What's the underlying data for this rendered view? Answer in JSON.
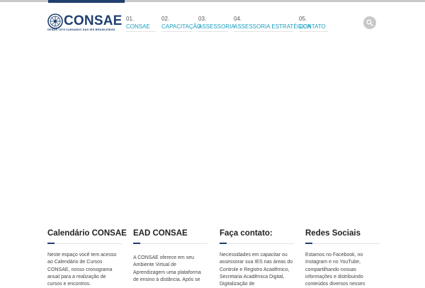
{
  "header": {
    "logo": {
      "name": "CONSAE",
      "tagline": "DESDE 1978 CUIDANDO DAS IES BRASILEIRAS"
    },
    "nav": [
      {
        "num": "01.",
        "label": "CONSAE"
      },
      {
        "num": "02.",
        "label": "CAPACITAÇÃO"
      },
      {
        "num": "03.",
        "label": "ASSESSORIA"
      },
      {
        "num": "04.",
        "label": "ASSESSORIA ESTRATÉGICA"
      },
      {
        "num": "05.",
        "label": "CONTATO"
      }
    ],
    "search_icon": "search-icon"
  },
  "colors": {
    "brand": "#1f3f6e",
    "link": "#1a9ec0",
    "search_bg": "#c8c8c8"
  },
  "footer": {
    "columns": [
      {
        "title": "Calendário CONSAE",
        "text": "Neste espaço você tem acesso ao Calendário de Cursos CONSAE, nosso cronograma anual para a realização de cursos e encontros."
      },
      {
        "title": "EAD CONSAE",
        "text": "A CONSAE oferece em seu Ambiente Virtual de Aprendizagem uma plataforma de ensino à distância. Após se"
      },
      {
        "title": "Faça contato:",
        "text": "Necessidades em capacitar ou assessorar sua IES nas áreas do Controle e Registro Acadêmico, Secretaria Acadêmica Digital, Digitalização de"
      },
      {
        "title": "Redes Sociais",
        "text": "Estamos no Facebook, no Instagram e no YouTube, compartilhando nossas informações e distribuindo conteúdos diversos nesses"
      }
    ]
  }
}
